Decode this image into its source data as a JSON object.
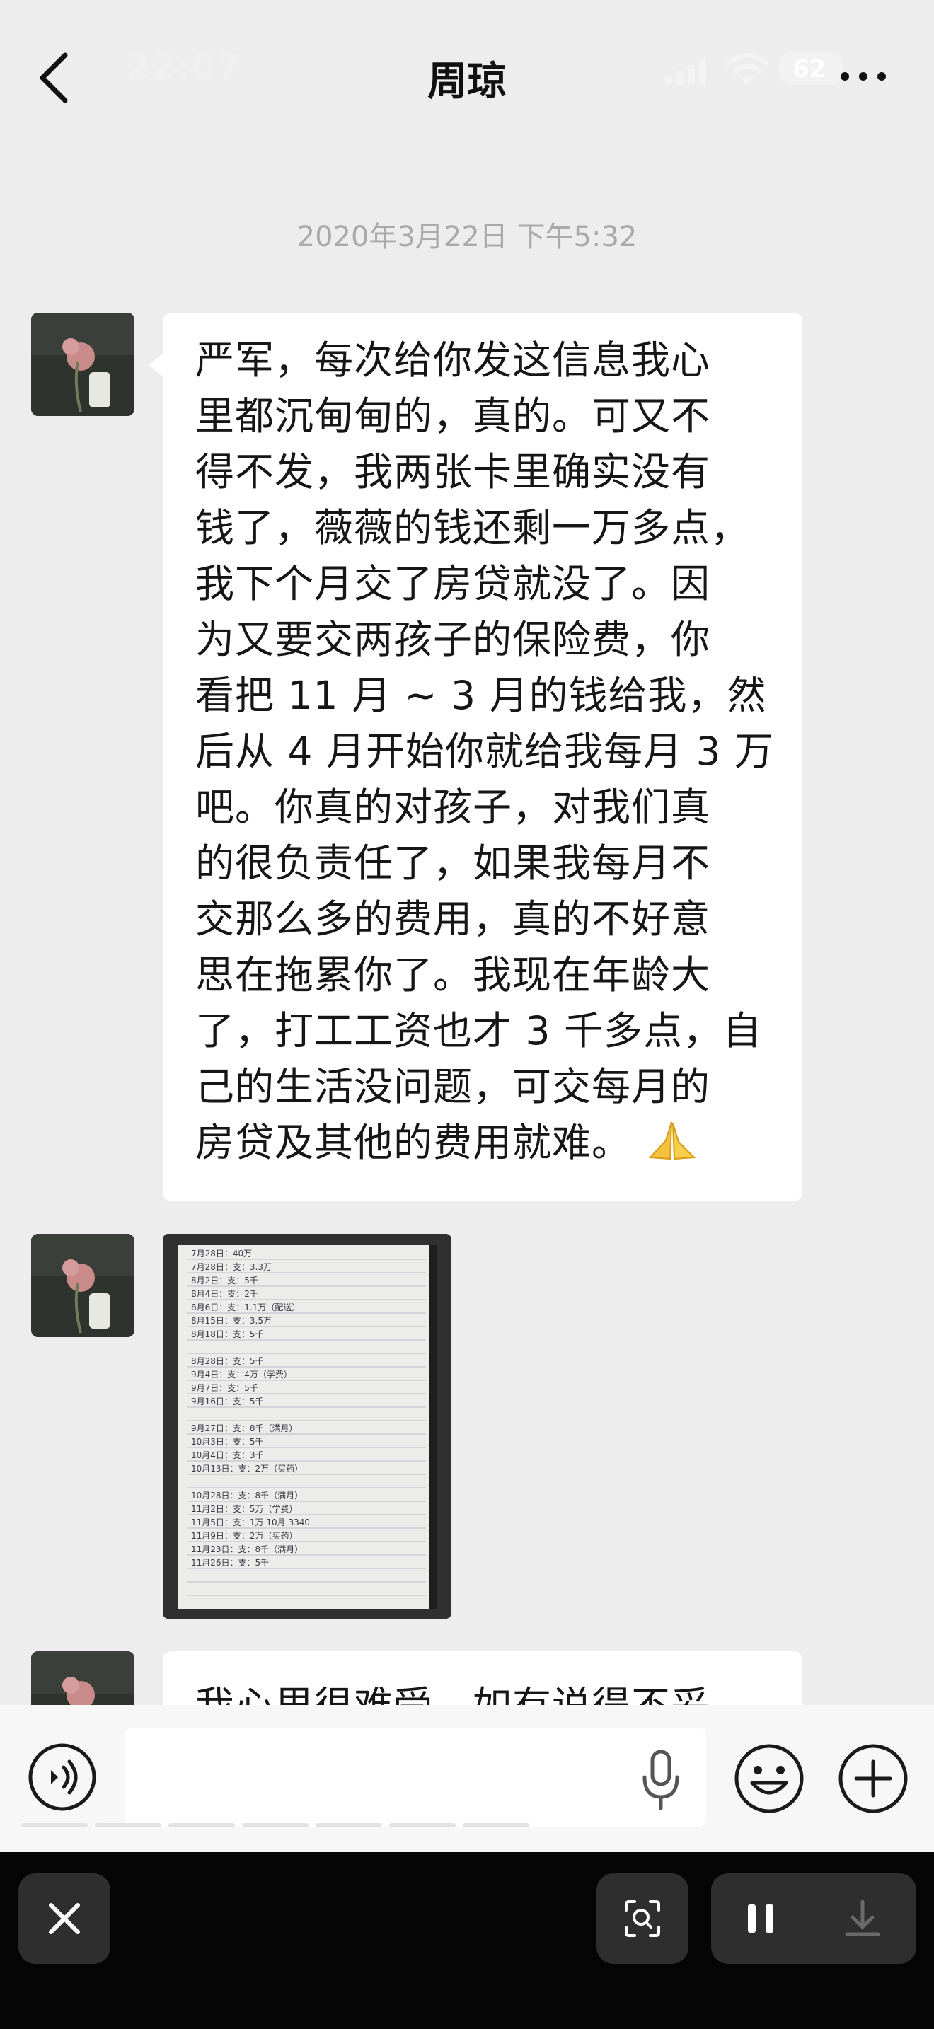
{
  "header": {
    "status_time": "22:07",
    "title": "周琼",
    "battery": "62",
    "icons": [
      "back-chevron-icon",
      "signal-icon",
      "wifi-icon",
      "battery-icon",
      "more-icon"
    ]
  },
  "timestamp": "2020年3月22日 下午5:32",
  "messages": [
    {
      "type": "text",
      "lines": [
        "严军，每次给你发这信息我心",
        "里都沉甸甸的，真的。可又不",
        "得不发，我两张卡里确实没有",
        "钱了，薇薇的钱还剩一万多点，",
        "我下个月交了房贷就没了。因",
        "为又要交两孩子的保险费，你",
        "看把 11 月 ~ 3 月的钱给我，然",
        "后从 4 月开始你就给我每月 3 万",
        "吧。你真的对孩子，对我们真",
        "的很负责任了，如果我每月不",
        "交那么多的费用，真的不好意",
        "思在拖累你了。我现在年龄大",
        "了，打工工资也才 3 千多点，自",
        "己的生活没问题，可交每月的",
        "房贷及其他的费用就难。"
      ],
      "emoji": "praying-hands-icon"
    },
    {
      "type": "image",
      "notebook_lines": [
        "7月28日：40万",
        "7月28日：支：3.3万",
        "8月2日：支：5千",
        "8月4日：支：2千",
        "8月6日：支：1.1万（配送）",
        "8月15日：支：3.5万",
        "8月18日：支：5千",
        "8月28日：支：5千",
        "9月4日：支：4万（学费）",
        "9月7日：支：5千",
        "9月16日：支：5千",
        "9月27日：支：8千（满月）",
        "10月3日：支：5千",
        "10月4日：支：3千",
        "10月13日：支：2万（买药）",
        "10月28日：支：8千（满月）",
        "11月2日：支：5万（学费）",
        "11月5日：支：1万 10月 3340",
        "11月9日：支：2万（买药）",
        "11月23日：支：8千（满月）",
        "11月26日：支：5千"
      ]
    },
    {
      "type": "text",
      "partial_line": "我心里很难受，如有说得不妥"
    }
  ],
  "input_bar": {
    "icons": [
      "voice-icon",
      "microphone-icon",
      "emoji-icon",
      "plus-icon"
    ]
  },
  "bottom_bar": {
    "icons": [
      "close-icon",
      "scan-icon",
      "pause-icon",
      "download-icon"
    ]
  },
  "colors": {
    "background": "#ededed",
    "bubble": "#ffffff",
    "timestamp": "#aaaaaa",
    "bottom_bar": "#050505"
  }
}
